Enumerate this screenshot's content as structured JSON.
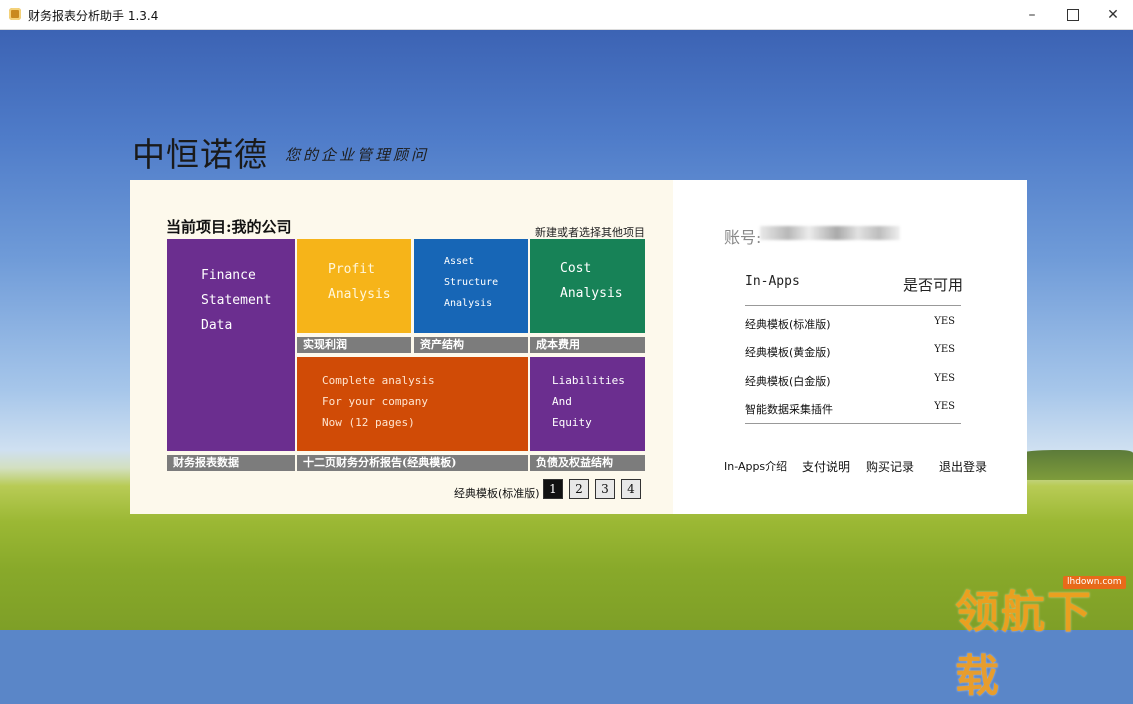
{
  "window": {
    "title": "财务报表分析助手 1.3.4",
    "minimize": "–",
    "close": "✕"
  },
  "brand": {
    "name": "中恒诺德",
    "slogan": "您的企业管理顾问"
  },
  "project": {
    "title": "当前项目:我的公司",
    "new_link": "新建或者选择其他项目"
  },
  "tiles": {
    "finance": {
      "text": "Finance\nStatement\nData",
      "label": "财务报表数据",
      "color": "#6b2e8f"
    },
    "profit": {
      "text": "Profit\nAnalysis",
      "label": "实现利润",
      "color": "#f6b419"
    },
    "asset": {
      "text": "Asset\nStructure\nAnalysis",
      "label": "资产结构",
      "color": "#1766b6"
    },
    "cost": {
      "text": "Cost\nAnalysis",
      "label": "成本费用",
      "color": "#178257"
    },
    "complete": {
      "text": "Complete analysis\nFor your company\nNow (12 pages)",
      "label": "十二页财务分析报告(经典模板)",
      "color": "#d04b06"
    },
    "liabilities": {
      "text": "Liabilities\nAnd\nEquity",
      "label": "负债及权益结构",
      "color": "#6b2e8f"
    }
  },
  "template": {
    "label": "经典模板(标准版)",
    "pages": [
      "1",
      "2",
      "3",
      "4"
    ],
    "active_page": "1"
  },
  "account": {
    "label": "账号:",
    "value": "••••••••••"
  },
  "inapps": {
    "header_name": "In-Apps",
    "header_available": "是否可用",
    "items": [
      {
        "name": "经典模板(标准版)",
        "available": "YES"
      },
      {
        "name": "经典模板(黄金版)",
        "available": "YES"
      },
      {
        "name": "经典模板(白金版)",
        "available": "YES"
      },
      {
        "name": "智能数据采集插件",
        "available": "YES"
      }
    ]
  },
  "links": {
    "intro": "In-Apps介绍",
    "payment": "支付说明",
    "history": "购买记录",
    "logout": "退出登录"
  },
  "watermark": {
    "site": "lhdown.com",
    "text": "领航下载"
  }
}
